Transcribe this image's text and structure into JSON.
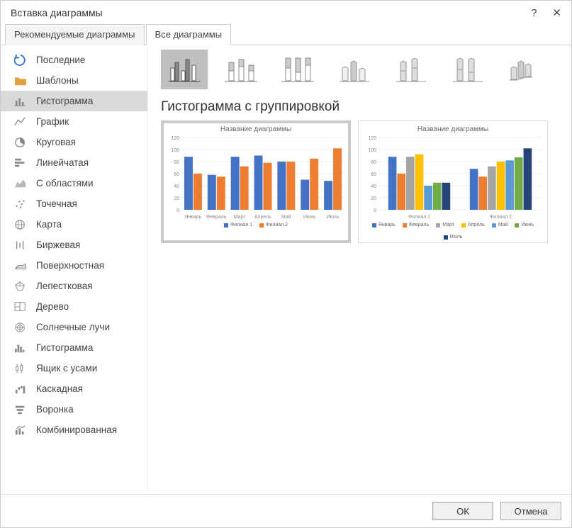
{
  "dialog": {
    "title": "Вставка диаграммы"
  },
  "tabs": {
    "recommended": "Рекомендуемые диаграммы",
    "all": "Все диаграммы"
  },
  "sidebar": {
    "items": [
      {
        "label": "Последние"
      },
      {
        "label": "Шаблоны"
      },
      {
        "label": "Гистограмма"
      },
      {
        "label": "График"
      },
      {
        "label": "Круговая"
      },
      {
        "label": "Линейчатая"
      },
      {
        "label": "С областями"
      },
      {
        "label": "Точечная"
      },
      {
        "label": "Карта"
      },
      {
        "label": "Биржевая"
      },
      {
        "label": "Поверхностная"
      },
      {
        "label": "Лепестковая"
      },
      {
        "label": "Дерево"
      },
      {
        "label": "Солнечные лучи"
      },
      {
        "label": "Гистограмма"
      },
      {
        "label": "Ящик с усами"
      },
      {
        "label": "Каскадная"
      },
      {
        "label": "Воронка"
      },
      {
        "label": "Комбинированная"
      }
    ]
  },
  "heading": "Гистограмма с группировкой",
  "preview_title": "Название диаграммы",
  "chart_data": [
    {
      "type": "bar",
      "title": "Название диаграммы",
      "categories": [
        "Январь",
        "Февраль",
        "Март",
        "Апрель",
        "Май",
        "Июнь",
        "Июль"
      ],
      "series": [
        {
          "name": "Филиал 1",
          "color": "#4472C4",
          "values": [
            88,
            58,
            88,
            90,
            80,
            50,
            48
          ]
        },
        {
          "name": "Филиал 2",
          "color": "#ED7D31",
          "values": [
            60,
            55,
            72,
            78,
            80,
            85,
            102
          ]
        }
      ],
      "ylim": [
        0,
        120
      ],
      "ytick": 20
    },
    {
      "type": "bar",
      "title": "Название диаграммы",
      "categories": [
        "Филиал 1",
        "Филиал 2"
      ],
      "series": [
        {
          "name": "Январь",
          "color": "#4472C4",
          "values": [
            88,
            68
          ]
        },
        {
          "name": "Февраль",
          "color": "#ED7D31",
          "values": [
            60,
            55
          ]
        },
        {
          "name": "Март",
          "color": "#A5A5A5",
          "values": [
            88,
            72
          ]
        },
        {
          "name": "Апрель",
          "color": "#FFC000",
          "values": [
            92,
            80
          ]
        },
        {
          "name": "Май",
          "color": "#5B9BD5",
          "values": [
            40,
            82
          ]
        },
        {
          "name": "Июнь",
          "color": "#70AD47",
          "values": [
            45,
            87
          ]
        },
        {
          "name": "Июль",
          "color": "#264478",
          "values": [
            45,
            102
          ]
        }
      ],
      "ylim": [
        0,
        120
      ],
      "ytick": 20
    }
  ],
  "buttons": {
    "ok": "ОК",
    "cancel": "Отмена"
  }
}
